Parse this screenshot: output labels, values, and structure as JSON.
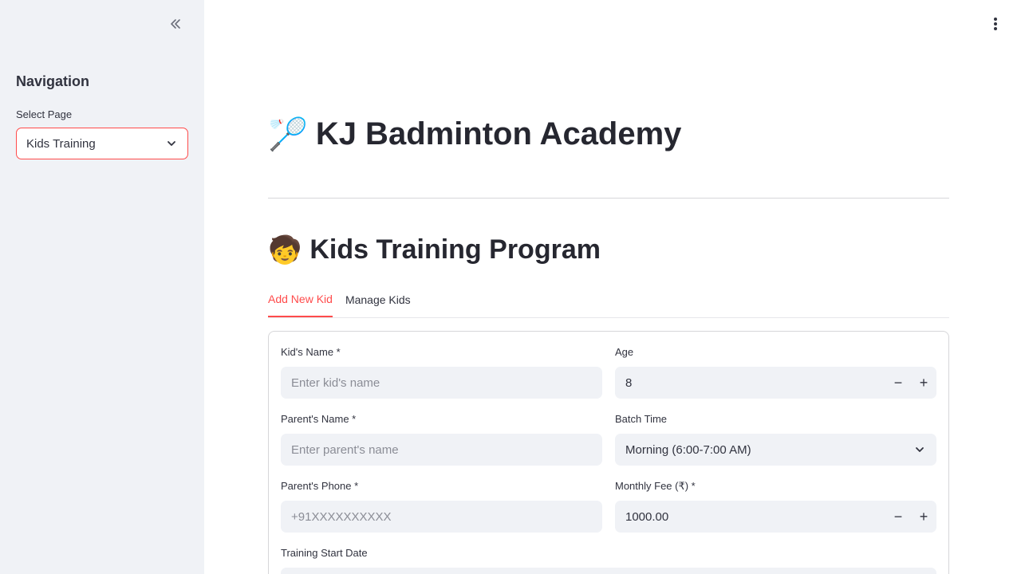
{
  "sidebar": {
    "nav_title": "Navigation",
    "select_label": "Select Page",
    "selected_page": "Kids Training"
  },
  "header": {
    "app_title": "KJ Badminton Academy",
    "app_emoji": "🏸"
  },
  "section": {
    "title": "Kids Training Program",
    "emoji": "🧒"
  },
  "tabs": [
    {
      "label": "Add New Kid",
      "active": true
    },
    {
      "label": "Manage Kids",
      "active": false
    }
  ],
  "form": {
    "kid_name": {
      "label": "Kid's Name *",
      "placeholder": "Enter kid's name"
    },
    "age": {
      "label": "Age",
      "value": "8",
      "minus": "−",
      "plus": "+"
    },
    "parent_name": {
      "label": "Parent's Name *",
      "placeholder": "Enter parent's name"
    },
    "batch_time": {
      "label": "Batch Time",
      "value": "Morning (6:00-7:00 AM)"
    },
    "parent_phone": {
      "label": "Parent's Phone *",
      "placeholder": "+91XXXXXXXXXX"
    },
    "monthly_fee": {
      "label": "Monthly Fee (₹) *",
      "value": "1000.00",
      "minus": "−",
      "plus": "+"
    },
    "start_date": {
      "label": "Training Start Date"
    }
  },
  "colors": {
    "accent": "#ff4b4b",
    "sidebar_bg": "#f0f2f6",
    "input_bg": "#f0f2f6",
    "text": "#31333f"
  },
  "icons": {
    "collapse": "chevrons-left-icon",
    "menu": "kebab-menu-icon",
    "dropdown": "chevron-down-icon"
  }
}
